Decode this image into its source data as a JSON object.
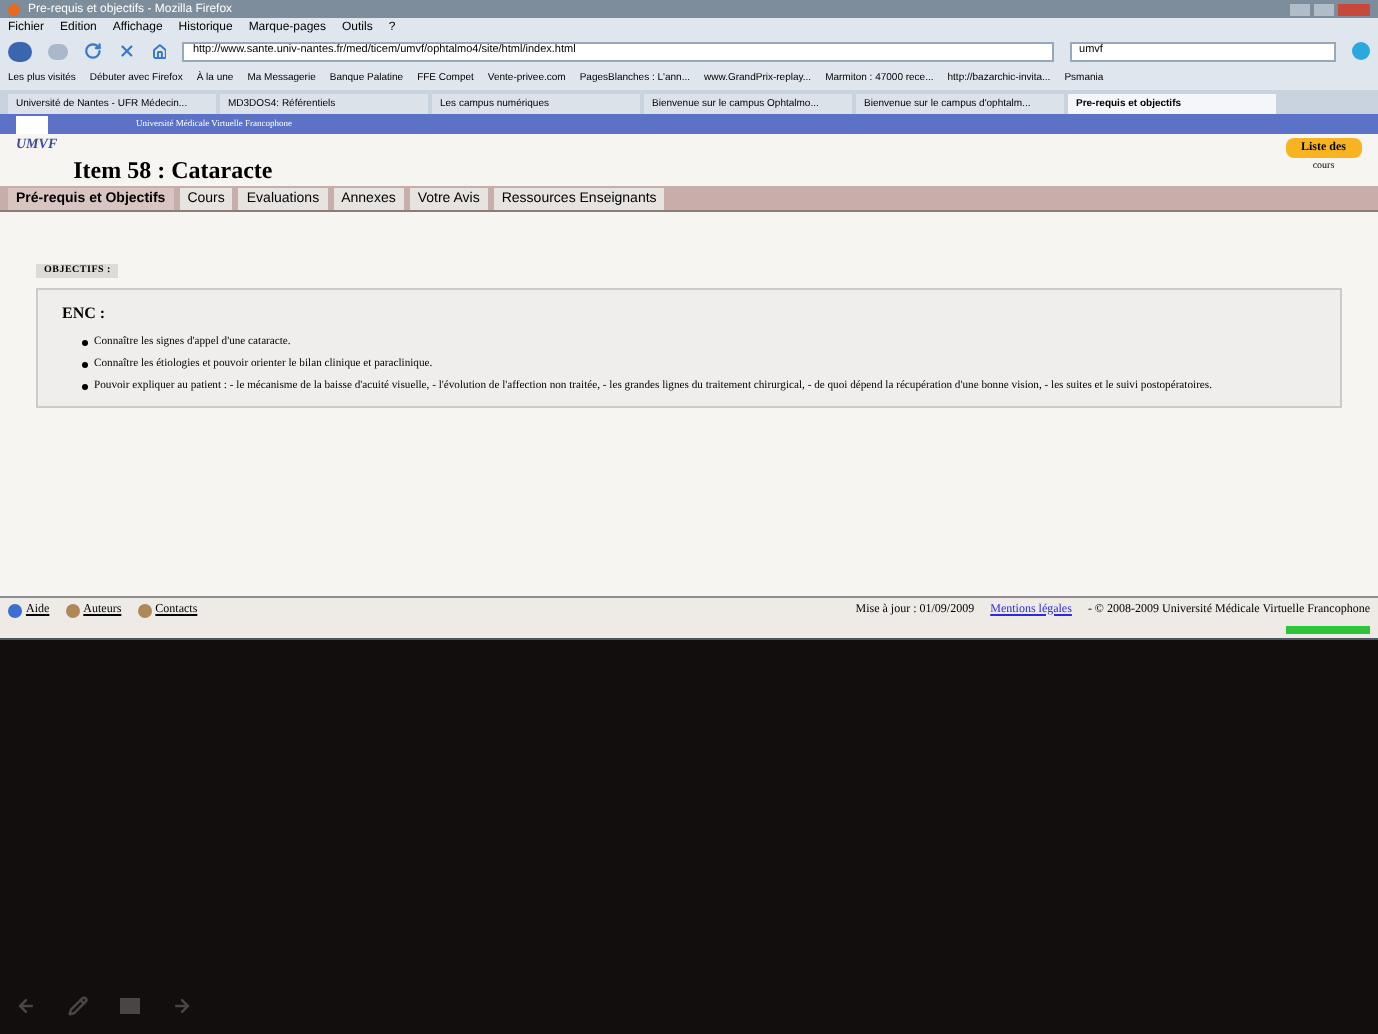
{
  "window": {
    "title": "Pre-requis et objectifs - Mozilla Firefox"
  },
  "menu": [
    "Fichier",
    "Edition",
    "Affichage",
    "Historique",
    "Marque-pages",
    "Outils",
    "?"
  ],
  "address": {
    "value": "http://www.sante.univ-nantes.fr/med/ticem/umvf/ophtalmo4/site/html/index.html"
  },
  "search": {
    "value": "umvf"
  },
  "bookmarks": [
    "Les plus visités",
    "Débuter avec Firefox",
    "À la une",
    "Ma Messagerie",
    "Banque Palatine",
    "FFE Compet",
    "Vente-privee.com",
    "PagesBlanches : L'ann...",
    "www.GrandPrix-replay...",
    "Marmiton : 47000 rece...",
    "http://bazarchic-invita...",
    "Psmania"
  ],
  "tabs": [
    {
      "label": "Université de Nantes - UFR Médecin...",
      "selected": false
    },
    {
      "label": "MD3DOS4: Référentiels",
      "selected": false
    },
    {
      "label": "Les campus numériques",
      "selected": false
    },
    {
      "label": "Bienvenue sur le campus Ophtalmo...",
      "selected": false
    },
    {
      "label": "Bienvenue sur le campus d'ophtalm...",
      "selected": false
    },
    {
      "label": "Pre-requis et objectifs",
      "selected": true
    }
  ],
  "site": {
    "logo": "UMVF",
    "tagline": "Université Médicale Virtuelle Francophone",
    "title": "Item 58 : Cataracte",
    "course_list": "Liste des",
    "course_list_2": "cours"
  },
  "nav": [
    {
      "label": "Pré-requis et Objectifs",
      "selected": true
    },
    {
      "label": "Cours",
      "selected": false
    },
    {
      "label": "Evaluations",
      "selected": false
    },
    {
      "label": "Annexes",
      "selected": false
    },
    {
      "label": "Votre Avis",
      "selected": false
    },
    {
      "label": "Ressources Enseignants",
      "selected": false
    }
  ],
  "objectives": {
    "tab": "OBJECTIFS :",
    "heading": "ENC :",
    "items": [
      "Connaître les signes d'appel d'une cataracte.",
      "Connaître les étiologies et pouvoir orienter le bilan clinique et paraclinique.",
      "Pouvoir expliquer au patient : - le mécanisme de la baisse d'acuité visuelle, - l'évolution de l'affection non traitée, - les grandes lignes du traitement chirurgical, - de quoi dépend la récupération d'une bonne vision, - les suites et le suivi postopératoires."
    ]
  },
  "footer": {
    "links": [
      "Aide",
      "Auteurs",
      "Contacts"
    ],
    "updated": "Mise à jour : 01/09/2009",
    "legal": "Mentions légales",
    "copyright": "- © 2008-2009 Université Médicale Virtuelle Francophone"
  },
  "progress": {
    "level": 1
  }
}
